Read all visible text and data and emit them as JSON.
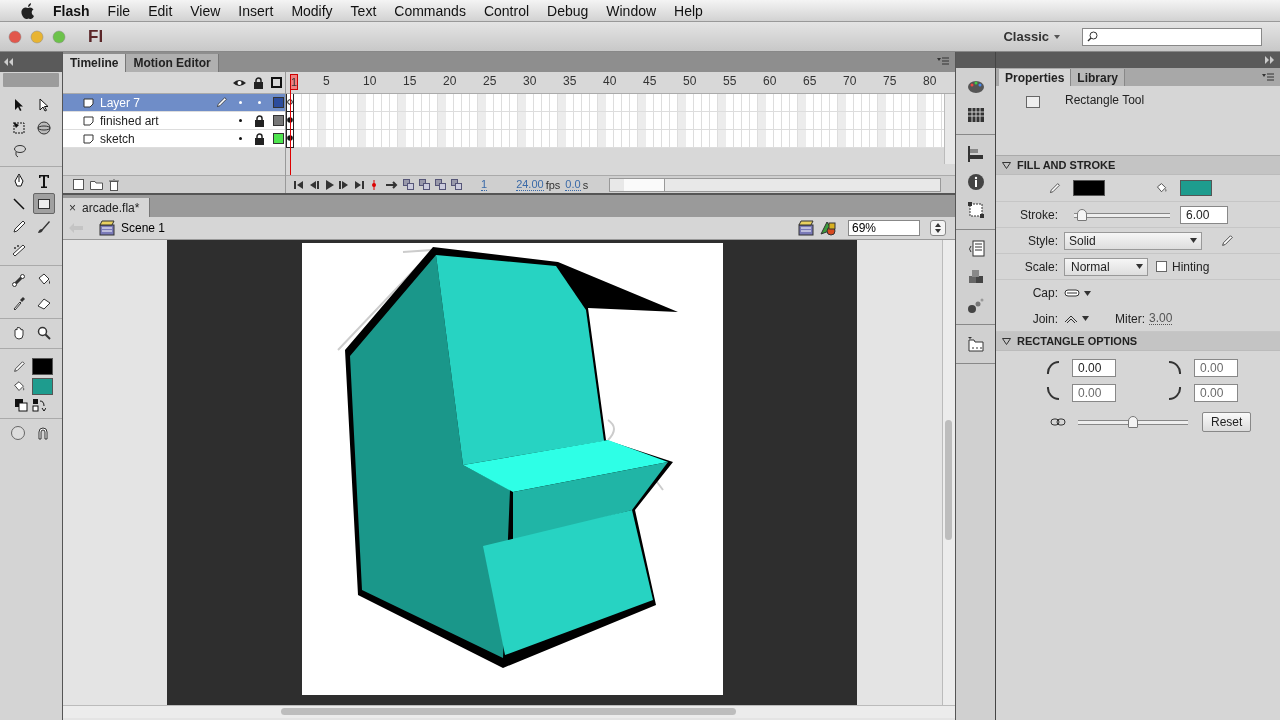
{
  "menu_bar": {
    "items": [
      {
        "label": "Flash",
        "kind": "app"
      },
      {
        "label": "File",
        "kind": "menu"
      },
      {
        "label": "Edit",
        "kind": "menu"
      },
      {
        "label": "View",
        "kind": "menu"
      },
      {
        "label": "Insert",
        "kind": "menu"
      },
      {
        "label": "Modify",
        "kind": "menu"
      },
      {
        "label": "Text",
        "kind": "menu"
      },
      {
        "label": "Commands",
        "kind": "menu"
      },
      {
        "label": "Control",
        "kind": "menu"
      },
      {
        "label": "Debug",
        "kind": "menu"
      },
      {
        "label": "Window",
        "kind": "menu"
      },
      {
        "label": "Help",
        "kind": "menu"
      }
    ]
  },
  "title_bar": {
    "logo": "Fl",
    "workspace": "Classic"
  },
  "tool_groups": [
    [
      {
        "kind": "arrow",
        "selected": false
      },
      {
        "kind": "subselect",
        "selected": false
      },
      {
        "kind": "transform",
        "selected": false
      },
      {
        "kind": "rotate3d",
        "selected": false
      },
      {
        "kind": "lasso",
        "selected": false
      }
    ],
    [
      {
        "kind": "pen",
        "selected": false
      },
      {
        "kind": "text",
        "selected": false
      },
      {
        "kind": "line",
        "selected": false
      },
      {
        "kind": "rect",
        "selected": true
      },
      {
        "kind": "pencil",
        "selected": false
      },
      {
        "kind": "brush",
        "selected": false
      },
      {
        "kind": "deco",
        "selected": false
      }
    ],
    [
      {
        "kind": "bone",
        "selected": false
      },
      {
        "kind": "bucket",
        "selected": false
      },
      {
        "kind": "eyedropper",
        "selected": false
      },
      {
        "kind": "eraser",
        "selected": false
      }
    ],
    [
      {
        "kind": "hand",
        "selected": false
      },
      {
        "kind": "zoom",
        "selected": false
      }
    ]
  ],
  "tool_colors": [
    {
      "kind": "stroke",
      "color": "#000000"
    },
    {
      "kind": "fill",
      "color": "#1e9c8e"
    }
  ],
  "timeline": {
    "tabs": [
      {
        "label": "Timeline",
        "selected": true
      },
      {
        "label": "Motion Editor",
        "selected": false
      }
    ],
    "ruler": [
      "1",
      "5",
      "10",
      "15",
      "20",
      "25",
      "30",
      "35",
      "40",
      "45",
      "50",
      "55",
      "60",
      "65",
      "70",
      "75",
      "80"
    ],
    "layers": [
      {
        "name": "Layer 7",
        "selected": true,
        "locked": false,
        "color": "#2c4c9c",
        "empty_keyframe": true
      },
      {
        "name": "finished art",
        "selected": false,
        "locked": true,
        "color": "#777777",
        "empty_keyframe": false
      },
      {
        "name": "sketch",
        "selected": false,
        "locked": true,
        "color": "#4ee44e",
        "empty_keyframe": false
      }
    ],
    "current_frame": "1",
    "frame_rate": "24.00",
    "frame_rate_unit": "fps",
    "elapsed": "0.0",
    "elapsed_unit": "s"
  },
  "document": {
    "tab": {
      "label": "arcade.fla*",
      "close": "×"
    },
    "scene": "Scene 1",
    "zoom": "69%"
  },
  "panel": {
    "tabs": [
      {
        "label": "Properties",
        "selected": true
      },
      {
        "label": "Library",
        "selected": false
      }
    ],
    "tool": "Rectangle Tool",
    "fill_and_stroke": {
      "title": "FILL AND STROKE",
      "expanded": true,
      "swatches": [
        {
          "kind": "stroke",
          "color": "#000000"
        },
        {
          "kind": "fill",
          "color": "#1e9c8e"
        }
      ],
      "stroke": {
        "label": "Stroke:",
        "level": 0.04,
        "value": "6.00"
      },
      "style": {
        "label": "Style:",
        "value": "Solid"
      },
      "scale": {
        "label": "Scale:",
        "value": "Normal"
      },
      "hinting": {
        "label": "Hinting",
        "checked": false
      },
      "cap": {
        "label": "Cap:"
      },
      "join": {
        "label": "Join:"
      },
      "miter": {
        "label": "Miter:",
        "value": "3.00"
      }
    },
    "rectangle_options": {
      "title": "RECTANGLE OPTIONS",
      "expanded": true,
      "corners": [
        {
          "value": "0.00",
          "disabled": false
        },
        {
          "value": "0.00",
          "disabled": true
        },
        {
          "value": "0.00",
          "disabled": true
        },
        {
          "value": "0.00",
          "disabled": true
        }
      ],
      "radius": {
        "level": 0.5
      },
      "reset": "Reset"
    }
  }
}
